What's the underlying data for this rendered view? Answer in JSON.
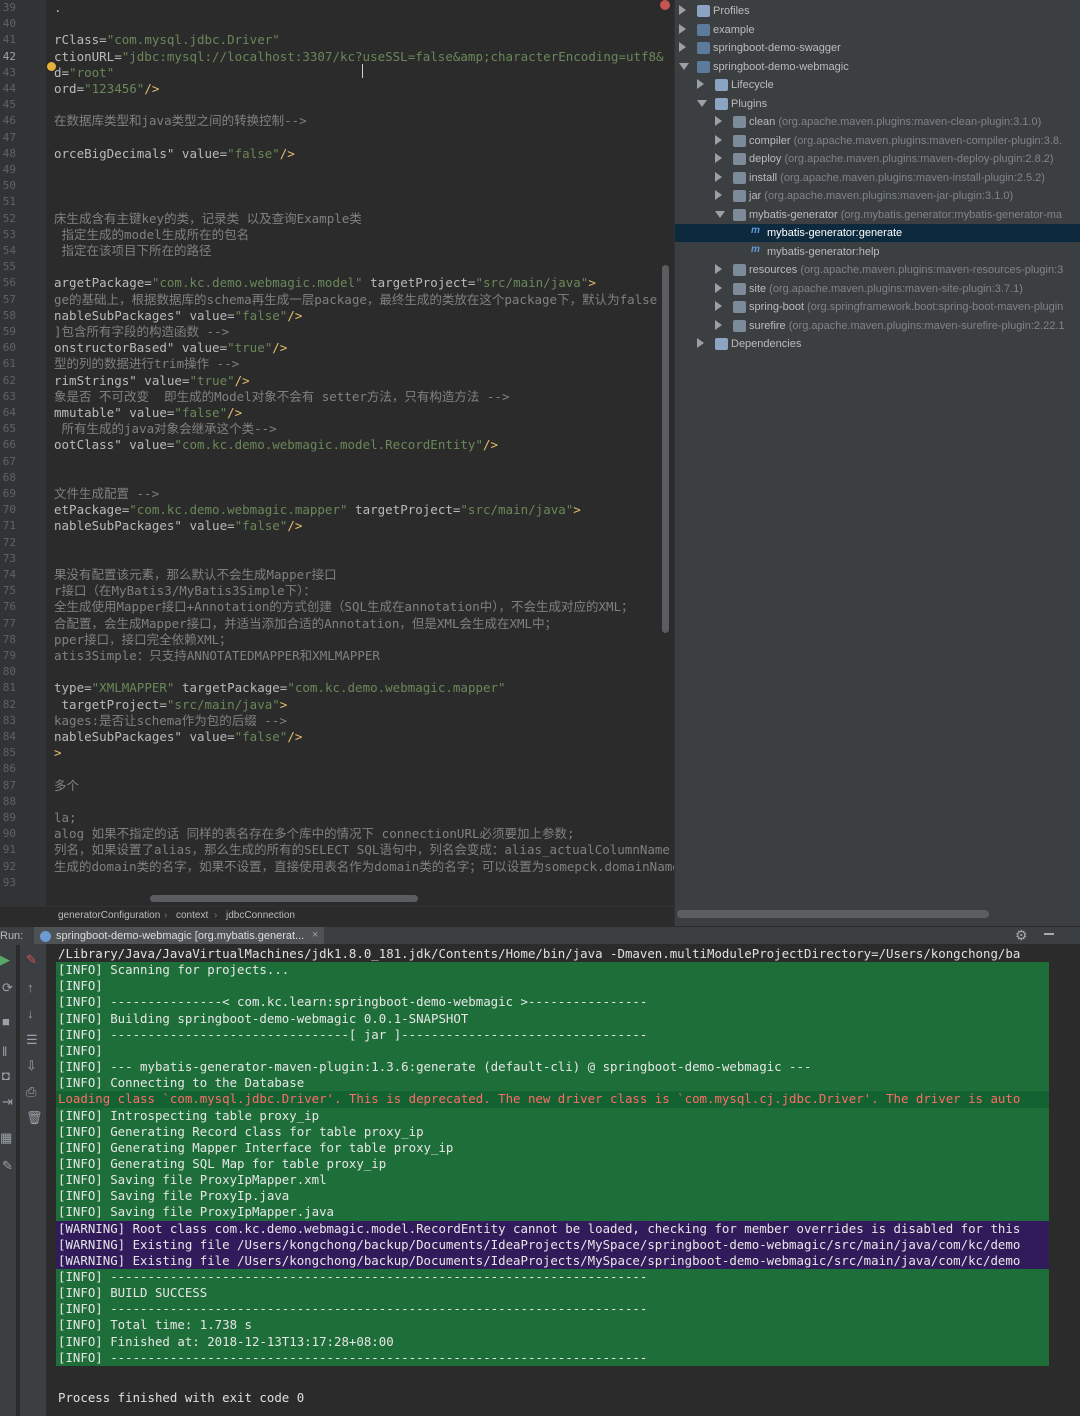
{
  "editor": {
    "line_numbers": [
      "39",
      "40",
      "41",
      "42",
      "43",
      "44",
      "45",
      "46",
      "47",
      "48",
      "49",
      "50",
      "51",
      "52",
      "53",
      "54",
      "55",
      "56",
      "57",
      "58",
      "59",
      "60",
      "61",
      "62",
      "63",
      "64",
      "65",
      "66",
      "67",
      "68",
      "69",
      "70",
      "71",
      "72",
      "73",
      "74",
      "75",
      "76",
      "77",
      "78",
      "79",
      "80",
      "81",
      "82",
      "83",
      "84",
      "85",
      "86",
      "87",
      "88",
      "89",
      "90",
      "91",
      "92",
      "93"
    ],
    "lines": [
      {
        "parts": [
          {
            "k": "p",
            "v": "."
          }
        ]
      },
      {
        "parts": []
      },
      {
        "parts": [
          {
            "k": "a",
            "v": "rClass="
          },
          {
            "k": "s",
            "v": "\"com.mysql.jdbc.Driver\""
          }
        ]
      },
      {
        "parts": [
          {
            "k": "a",
            "v": "ctionURL="
          },
          {
            "k": "s",
            "v": "\"jdbc:mysql://localhost:3307/kc?useSSL=false&amp;characterEncoding=utf8&"
          }
        ]
      },
      {
        "parts": [
          {
            "k": "a",
            "v": "d="
          },
          {
            "k": "s",
            "v": "\"root\""
          }
        ]
      },
      {
        "parts": [
          {
            "k": "a",
            "v": "ord="
          },
          {
            "k": "s",
            "v": "\"123456\""
          },
          {
            "k": "t",
            "v": "/>"
          }
        ]
      },
      {
        "parts": []
      },
      {
        "parts": [
          {
            "k": "c",
            "v": "在数据库类型和java类型之间的转换控制-->"
          }
        ]
      },
      {
        "parts": []
      },
      {
        "parts": [
          {
            "k": "a",
            "v": "orceBigDecimals\" value="
          },
          {
            "k": "s",
            "v": "\"false\""
          },
          {
            "k": "t",
            "v": "/>"
          }
        ]
      },
      {
        "parts": []
      },
      {
        "parts": []
      },
      {
        "parts": []
      },
      {
        "parts": [
          {
            "k": "c",
            "v": "床生成含有主键key的类，记录类 以及查询Example类"
          }
        ]
      },
      {
        "parts": [
          {
            "k": "c",
            "v": " 指定生成的model生成所在的包名"
          }
        ]
      },
      {
        "parts": [
          {
            "k": "c",
            "v": " 指定在该项目下所在的路径"
          }
        ]
      },
      {
        "parts": []
      },
      {
        "parts": [
          {
            "k": "a",
            "v": "argetPackage="
          },
          {
            "k": "s",
            "v": "\"com.kc.demo.webmagic.model\""
          },
          {
            "k": "a",
            "v": " targetProject="
          },
          {
            "k": "s",
            "v": "\"src/main/java\""
          },
          {
            "k": "t",
            "v": ">"
          }
        ]
      },
      {
        "parts": [
          {
            "k": "c",
            "v": "ge的基础上，根据数据库的schema再生成一层package，最终生成的类放在这个package下，默认为false"
          }
        ]
      },
      {
        "parts": [
          {
            "k": "a",
            "v": "nableSubPackages\" value="
          },
          {
            "k": "s",
            "v": "\"false\""
          },
          {
            "k": "t",
            "v": "/>"
          }
        ]
      },
      {
        "parts": [
          {
            "k": "c",
            "v": "]包含所有字段的构造函数 -->"
          }
        ]
      },
      {
        "parts": [
          {
            "k": "a",
            "v": "onstructorBased\" value="
          },
          {
            "k": "s",
            "v": "\"true\""
          },
          {
            "k": "t",
            "v": "/>"
          }
        ]
      },
      {
        "parts": [
          {
            "k": "c",
            "v": "型的列的数据进行trim操作 -->"
          }
        ]
      },
      {
        "parts": [
          {
            "k": "a",
            "v": "rimStrings\" value="
          },
          {
            "k": "s",
            "v": "\"true\""
          },
          {
            "k": "t",
            "v": "/>"
          }
        ]
      },
      {
        "parts": [
          {
            "k": "c",
            "v": "象是否 不可改变  即生成的Model对象不会有 setter方法，只有构造方法 -->"
          }
        ]
      },
      {
        "parts": [
          {
            "k": "a",
            "v": "mmutable\" value="
          },
          {
            "k": "s",
            "v": "\"false\""
          },
          {
            "k": "t",
            "v": "/>"
          }
        ]
      },
      {
        "parts": [
          {
            "k": "c",
            "v": " 所有生成的java对象会继承这个类-->"
          }
        ]
      },
      {
        "parts": [
          {
            "k": "a",
            "v": "ootClass\" value="
          },
          {
            "k": "s",
            "v": "\"com.kc.demo.webmagic.model.RecordEntity\""
          },
          {
            "k": "t",
            "v": "/>"
          }
        ]
      },
      {
        "parts": []
      },
      {
        "parts": []
      },
      {
        "parts": [
          {
            "k": "c",
            "v": "文件生成配置 -->"
          }
        ]
      },
      {
        "parts": [
          {
            "k": "a",
            "v": "etPackage="
          },
          {
            "k": "s",
            "v": "\"com.kc.demo.webmagic.mapper\""
          },
          {
            "k": "a",
            "v": " targetProject="
          },
          {
            "k": "s",
            "v": "\"src/main/java\""
          },
          {
            "k": "t",
            "v": ">"
          }
        ]
      },
      {
        "parts": [
          {
            "k": "a",
            "v": "nableSubPackages\" value="
          },
          {
            "k": "s",
            "v": "\"false\""
          },
          {
            "k": "t",
            "v": "/>"
          }
        ]
      },
      {
        "parts": []
      },
      {
        "parts": []
      },
      {
        "parts": [
          {
            "k": "c",
            "v": "果没有配置该元素，那么默认不会生成Mapper接口"
          }
        ]
      },
      {
        "parts": [
          {
            "k": "c",
            "v": "r接口（在MyBatis3/MyBatis3Simple下）："
          }
        ]
      },
      {
        "parts": [
          {
            "k": "c",
            "v": "全生成使用Mapper接口+Annotation的方式创建（SQL生成在annotation中），不会生成对应的XML；"
          }
        ]
      },
      {
        "parts": [
          {
            "k": "c",
            "v": "合配置，会生成Mapper接口，并适当添加合适的Annotation，但是XML会生成在XML中；"
          }
        ]
      },
      {
        "parts": [
          {
            "k": "c",
            "v": "pper接口，接口完全依赖XML；"
          }
        ]
      },
      {
        "parts": [
          {
            "k": "c",
            "v": "atis3Simple：只支持ANNOTATEDMAPPER和XMLMAPPER"
          }
        ]
      },
      {
        "parts": []
      },
      {
        "parts": [
          {
            "k": "a",
            "v": "type="
          },
          {
            "k": "s",
            "v": "\"XMLMAPPER\""
          },
          {
            "k": "a",
            "v": " targetPackage="
          },
          {
            "k": "s",
            "v": "\"com.kc.demo.webmagic.mapper\""
          }
        ]
      },
      {
        "parts": [
          {
            "k": "a",
            "v": " targetProject="
          },
          {
            "k": "s",
            "v": "\"src/main/java\""
          },
          {
            "k": "t",
            "v": ">"
          }
        ]
      },
      {
        "parts": [
          {
            "k": "c",
            "v": "kages:是否让schema作为包的后缀 -->"
          }
        ]
      },
      {
        "parts": [
          {
            "k": "a",
            "v": "nableSubPackages\" value="
          },
          {
            "k": "s",
            "v": "\"false\""
          },
          {
            "k": "t",
            "v": "/>"
          }
        ]
      },
      {
        "parts": [
          {
            "k": "t",
            "v": ">"
          }
        ]
      },
      {
        "parts": []
      },
      {
        "parts": [
          {
            "k": "c",
            "v": "多个"
          }
        ]
      },
      {
        "parts": []
      },
      {
        "parts": [
          {
            "k": "c",
            "v": "la;"
          }
        ]
      },
      {
        "parts": [
          {
            "k": "c",
            "v": "alog 如果不指定的话 同样的表名存在多个库中的情况下 connectionURL必须要加上参数;"
          }
        ]
      },
      {
        "parts": [
          {
            "k": "c",
            "v": "列名，如果设置了alias，那么生成的所有的SELECT SQL语句中，列名会变成：alias_actualColumnName"
          }
        ]
      },
      {
        "parts": [
          {
            "k": "c",
            "v": "生成的domain类的名字，如果不设置，直接使用表名作为domain类的名字；可以设置为somepck.domainName"
          }
        ]
      },
      {
        "parts": []
      }
    ]
  },
  "maven": {
    "rows": [
      {
        "indent": 0,
        "arrow": "r",
        "icon": "folder",
        "label": "Profiles",
        "gray": ""
      },
      {
        "indent": 0,
        "arrow": "r",
        "icon": "mvn",
        "label": "example",
        "gray": ""
      },
      {
        "indent": 0,
        "arrow": "r",
        "icon": "mvn",
        "label": "springboot-demo-swagger",
        "gray": ""
      },
      {
        "indent": 0,
        "arrow": "d",
        "icon": "mvn",
        "label": "springboot-demo-webmagic",
        "gray": ""
      },
      {
        "indent": 1,
        "arrow": "r",
        "icon": "folder",
        "label": "Lifecycle",
        "gray": ""
      },
      {
        "indent": 1,
        "arrow": "d",
        "icon": "folder",
        "label": "Plugins",
        "gray": ""
      },
      {
        "indent": 2,
        "arrow": "r",
        "icon": "plug",
        "label": "clean",
        "gray": " (org.apache.maven.plugins:maven-clean-plugin:3.1.0)"
      },
      {
        "indent": 2,
        "arrow": "r",
        "icon": "plug",
        "label": "compiler",
        "gray": " (org.apache.maven.plugins:maven-compiler-plugin:3.8."
      },
      {
        "indent": 2,
        "arrow": "r",
        "icon": "plug",
        "label": "deploy",
        "gray": " (org.apache.maven.plugins:maven-deploy-plugin:2.8.2)"
      },
      {
        "indent": 2,
        "arrow": "r",
        "icon": "plug",
        "label": "install",
        "gray": " (org.apache.maven.plugins:maven-install-plugin:2.5.2)"
      },
      {
        "indent": 2,
        "arrow": "r",
        "icon": "plug",
        "label": "jar",
        "gray": " (org.apache.maven.plugins:maven-jar-plugin:3.1.0)"
      },
      {
        "indent": 2,
        "arrow": "d",
        "icon": "plug",
        "label": "mybatis-generator",
        "gray": " (org.mybatis.generator:mybatis-generator-ma"
      },
      {
        "indent": 3,
        "arrow": "",
        "icon": "goal",
        "label": "mybatis-generator:generate",
        "gray": "",
        "selected": true
      },
      {
        "indent": 3,
        "arrow": "",
        "icon": "goal",
        "label": "mybatis-generator:help",
        "gray": ""
      },
      {
        "indent": 2,
        "arrow": "r",
        "icon": "plug",
        "label": "resources",
        "gray": " (org.apache.maven.plugins:maven-resources-plugin:3"
      },
      {
        "indent": 2,
        "arrow": "r",
        "icon": "plug",
        "label": "site",
        "gray": " (org.apache.maven.plugins:maven-site-plugin:3.7.1)"
      },
      {
        "indent": 2,
        "arrow": "r",
        "icon": "plug",
        "label": "spring-boot",
        "gray": " (org.springframework.boot:spring-boot-maven-plugin"
      },
      {
        "indent": 2,
        "arrow": "r",
        "icon": "plug",
        "label": "surefire",
        "gray": " (org.apache.maven.plugins:maven-surefire-plugin:2.22.1"
      },
      {
        "indent": 1,
        "arrow": "r",
        "icon": "folder",
        "label": "Dependencies",
        "gray": ""
      }
    ]
  },
  "breadcrumb": {
    "items": [
      "generatorConfiguration",
      "context",
      "jdbcConnection"
    ],
    "sep": "›"
  },
  "run": {
    "label": "Run:",
    "tab_title": "springboot-demo-webmagic [org.mybatis.generat...",
    "close": "×",
    "gear": "⚙"
  },
  "console": {
    "lines": [
      {
        "style": "plain",
        "text": "/Library/Java/JavaVirtualMachines/jdk1.8.0_181.jdk/Contents/Home/bin/java -Dmaven.multiModuleProjectDirectory=/Users/kongchong/ba"
      },
      {
        "style": "green",
        "text": "[INFO] Scanning for projects..."
      },
      {
        "style": "green",
        "text": "[INFO]"
      },
      {
        "style": "green",
        "text": "[INFO] ---------------< com.kc.learn:springboot-demo-webmagic >----------------"
      },
      {
        "style": "green",
        "text": "[INFO] Building springboot-demo-webmagic 0.0.1-SNAPSHOT"
      },
      {
        "style": "green",
        "text": "[INFO] --------------------------------[ jar ]---------------------------------"
      },
      {
        "style": "green",
        "text": "[INFO]"
      },
      {
        "style": "green",
        "text": "[INFO] --- mybatis-generator-maven-plugin:1.3.6:generate (default-cli) @ springboot-demo-webmagic ---"
      },
      {
        "style": "green",
        "text": "[INFO] Connecting to the Database"
      },
      {
        "style": "red",
        "text": "Loading class `com.mysql.jdbc.Driver'. This is deprecated. The new driver class is `com.mysql.cj.jdbc.Driver'. The driver is auto"
      },
      {
        "style": "green",
        "text": "[INFO] Introspecting table proxy_ip"
      },
      {
        "style": "green",
        "text": "[INFO] Generating Record class for table proxy_ip"
      },
      {
        "style": "green",
        "text": "[INFO] Generating Mapper Interface for table proxy_ip"
      },
      {
        "style": "green",
        "text": "[INFO] Generating SQL Map for table proxy_ip"
      },
      {
        "style": "green",
        "text": "[INFO] Saving file ProxyIpMapper.xml"
      },
      {
        "style": "green",
        "text": "[INFO] Saving file ProxyIp.java"
      },
      {
        "style": "green",
        "text": "[INFO] Saving file ProxyIpMapper.java"
      },
      {
        "style": "purple",
        "text": "[WARNING] Root class com.kc.demo.webmagic.model.RecordEntity cannot be loaded, checking for member overrides is disabled for this"
      },
      {
        "style": "purple",
        "text": "[WARNING] Existing file /Users/kongchong/backup/Documents/IdeaProjects/MySpace/springboot-demo-webmagic/src/main/java/com/kc/demo"
      },
      {
        "style": "purple",
        "text": "[WARNING] Existing file /Users/kongchong/backup/Documents/IdeaProjects/MySpace/springboot-demo-webmagic/src/main/java/com/kc/demo"
      },
      {
        "style": "green",
        "text": "[INFO] ------------------------------------------------------------------------"
      },
      {
        "style": "green",
        "text": "[INFO] BUILD SUCCESS"
      },
      {
        "style": "green",
        "text": "[INFO] ------------------------------------------------------------------------"
      },
      {
        "style": "green",
        "text": "[INFO] Total time: 1.738 s"
      },
      {
        "style": "green",
        "text": "[INFO] Finished at: 2018-12-13T13:17:28+08:00"
      },
      {
        "style": "green",
        "text": "[INFO] ------------------------------------------------------------------------"
      },
      {
        "style": "blank",
        "text": ""
      },
      {
        "style": "plain",
        "text": "Process finished with exit code 0"
      }
    ]
  },
  "colors": {
    "editor_bg": "#2b2b2b",
    "console_green": "#1e6e3a",
    "console_purple": "#311b5b",
    "error_text": "#ff6b68",
    "selection": "#0d293e"
  },
  "icons": [
    "run-icon",
    "stop-icon",
    "rerun-icon",
    "scroll-up-icon",
    "scroll-down-icon",
    "soft-wrap-icon",
    "scroll-to-end-icon",
    "print-icon",
    "trash-icon",
    "gear-icon",
    "hide-icon",
    "close-icon",
    "maven-goal-icon",
    "folder-icon",
    "plugin-icon",
    "maven-module-icon",
    "error-marker-icon",
    "intention-bulb-icon"
  ]
}
